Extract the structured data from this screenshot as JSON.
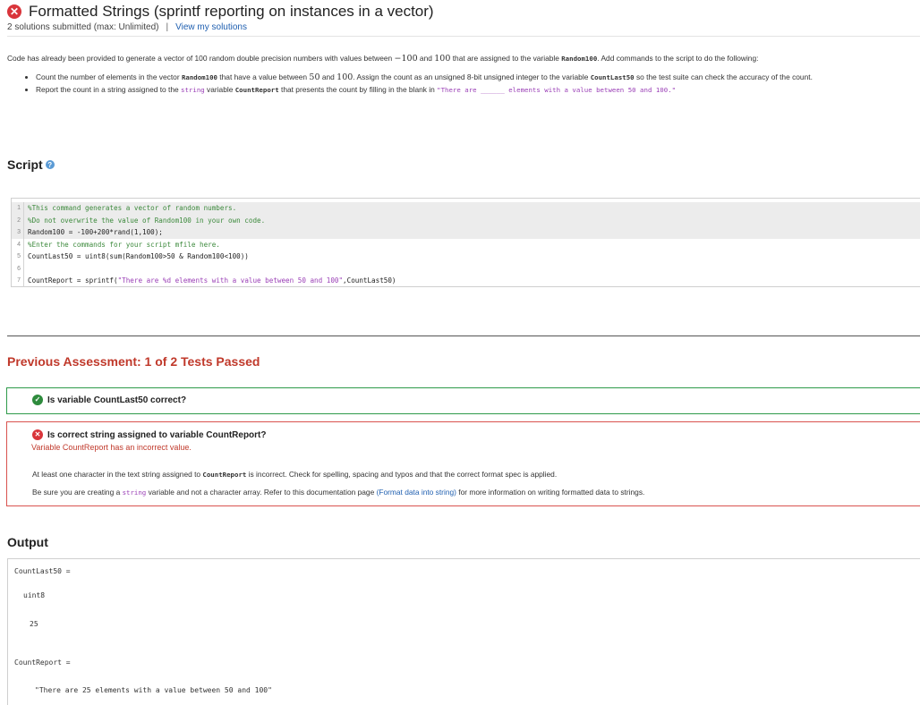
{
  "header": {
    "title": "Formatted Strings (sprintf reporting on instances in a vector)",
    "submitted": "2 solutions submitted (max: Unlimited)",
    "separator": "|",
    "view_solutions": "View my solutions"
  },
  "description": {
    "intro_before": "Code has already been provided to generate a vector of 100 random double precision numbers with values between ",
    "intro_range_low": "−100",
    "intro_and": " and ",
    "intro_range_high": "100",
    "intro_mid": " that are assigned to the variable ",
    "intro_var": "Random100",
    "intro_after": ". Add commands to the script to do the following:",
    "bullet1_a": "Count the number of elements in the vector ",
    "bullet1_var1": "Random100",
    "bullet1_b": " that have a value between ",
    "bullet1_low": "50",
    "bullet1_and": " and ",
    "bullet1_high": "100",
    "bullet1_c": ". Assign the count as an unsigned 8-bit unsigned integer to the variable ",
    "bullet1_var2": "CountLast50",
    "bullet1_d": " so the test suite can check the accuracy of the count.",
    "bullet2_a": "Report the count in a string assigned to the ",
    "bullet2_type": "string",
    "bullet2_b": " variable ",
    "bullet2_var": "CountReport",
    "bullet2_c": " that presents the count by filling in the blank in ",
    "bullet2_str": "\"There are ______ elements with a value between 50 and 100.\""
  },
  "script": {
    "heading": "Script",
    "help_icon": "?",
    "lines": [
      {
        "num": "1",
        "text": "%This command generates a vector of random numbers."
      },
      {
        "num": "2",
        "text": "%Do not overwrite the value of Random100 in your own code."
      },
      {
        "num": "3",
        "text": "Random100 = -100+200*rand(1,100);"
      },
      {
        "num": "4",
        "text": "%Enter the commands for your script mfile here."
      },
      {
        "num": "5",
        "text": "CountLast50 = uint8(sum(Random100>50 & Random100<100))"
      },
      {
        "num": "6",
        "text": ""
      },
      {
        "num": "7",
        "code": "CountReport = sprintf(",
        "str": "\"There are %d elements with a value between 50 and 100\"",
        "tail": ",CountLast50)"
      }
    ]
  },
  "assessment": {
    "heading": "Previous Assessment: 1 of 2 Tests Passed",
    "test1": {
      "title": "Is variable CountLast50 correct?"
    },
    "test2": {
      "title": "Is correct string assigned to variable CountReport?",
      "subtitle": "Variable CountReport has an incorrect value.",
      "msg1_a": "At least one character in the text string assigned to ",
      "msg1_var": "CountReport",
      "msg1_b": " is incorrect. Check for spelling, spacing and typos and that the correct format spec is applied.",
      "msg2_a": "Be sure you are creating a ",
      "msg2_type": "string",
      "msg2_b": " variable and not a character array.  Refer to this documentation page ",
      "msg2_link": "(Format data into string)",
      "msg2_c": " for more information on writing formatted data to strings."
    }
  },
  "output": {
    "heading": "Output",
    "lines": [
      "CountLast50 =",
      "uint8",
      "25",
      "CountReport =",
      "\"There are 25 elements with a value between 50 and 100\""
    ]
  }
}
